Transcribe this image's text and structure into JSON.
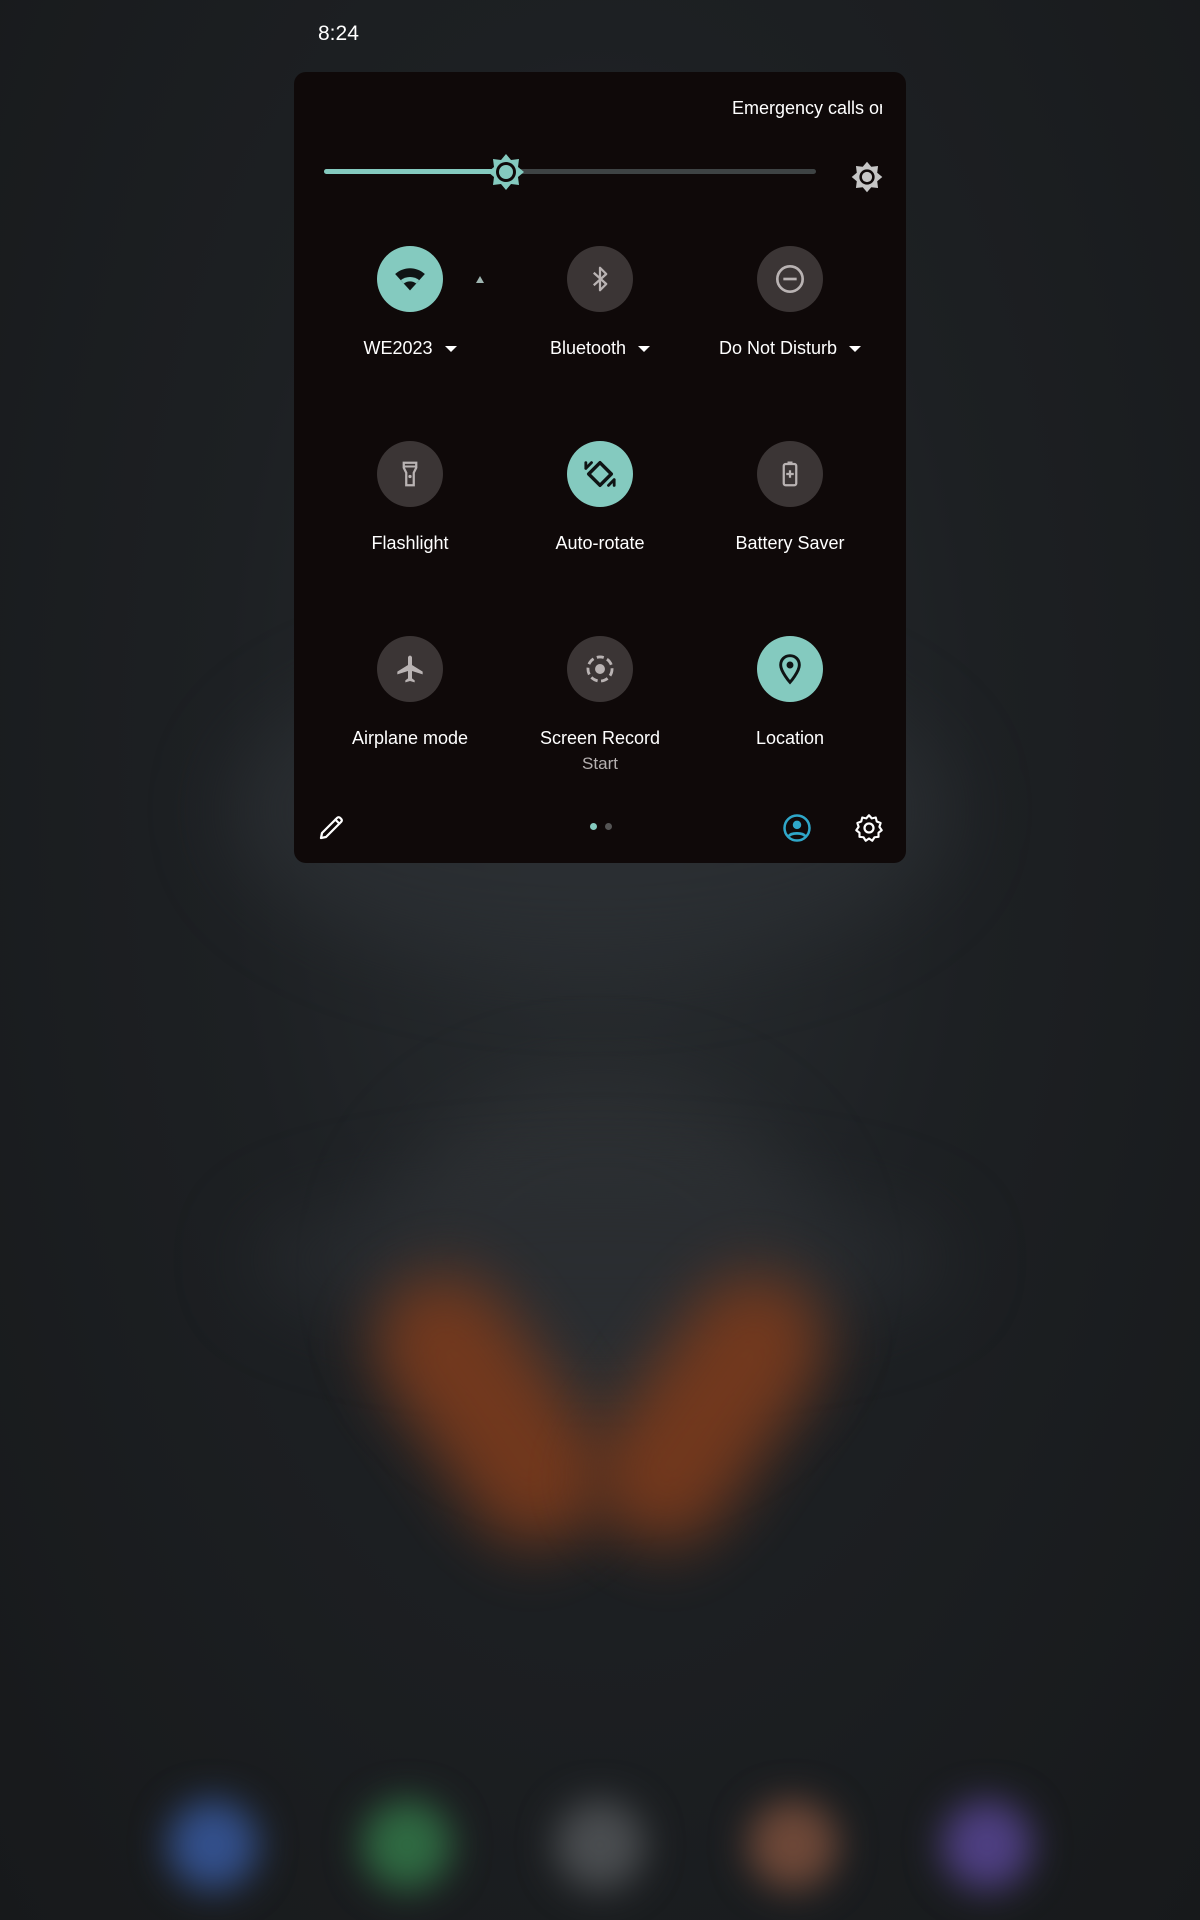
{
  "status_bar": {
    "time": "8:24"
  },
  "panel": {
    "carrier_text": "Emergency calls only",
    "brightness": {
      "level": 0.37,
      "fill_color": "#84cabf"
    },
    "tiles": [
      {
        "label": "WE2023",
        "icon": "wifi-icon",
        "active": true,
        "has_dropdown": true
      },
      {
        "label": "Bluetooth",
        "icon": "bluetooth-icon",
        "active": false,
        "has_dropdown": true
      },
      {
        "label": "Do Not Disturb",
        "icon": "do-not-disturb-icon",
        "active": false,
        "has_dropdown": true
      },
      {
        "label": "Flashlight",
        "icon": "flashlight-icon",
        "active": false
      },
      {
        "label": "Auto-rotate",
        "icon": "auto-rotate-icon",
        "active": true
      },
      {
        "label": "Battery Saver",
        "icon": "battery-saver-icon",
        "active": false
      },
      {
        "label": "Airplane mode",
        "icon": "airplane-icon",
        "active": false
      },
      {
        "label": "Screen Record",
        "sub": "Start",
        "icon": "screen-record-icon",
        "active": false
      },
      {
        "label": "Location",
        "icon": "location-icon",
        "active": true
      }
    ],
    "page_indicator": {
      "current": 1,
      "total": 2
    }
  },
  "colors": {
    "accent": "#84cabf",
    "tile_off": "#3b3535",
    "panel_bg": "#0f0909",
    "user_icon": "#2fa7c9"
  }
}
